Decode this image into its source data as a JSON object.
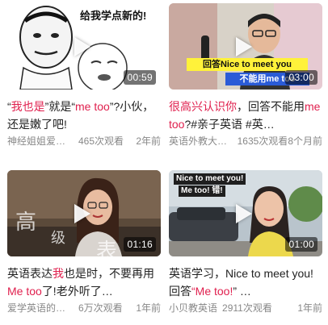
{
  "videos": [
    {
      "duration": "00:59",
      "title": [
        "“",
        "我也是",
        "”就是“",
        "me too",
        "”?小伙，还是嫩了吧!"
      ],
      "author": "神经姐姐爱英…",
      "views": "465次观看",
      "age": "2年前",
      "thumb_text": [
        "给我学点新的!"
      ]
    },
    {
      "duration": "03:00",
      "title": [
        "",
        "很高兴认识你",
        "，回答不能用",
        "me too",
        "?#亲子英语 #英…"
      ],
      "author": "英语外教大卫…",
      "views": "1635次观看",
      "age": "8个月前",
      "thumb_text": [
        "回答Nice to meet you",
        "不能用me too"
      ]
    },
    {
      "duration": "01:16",
      "title": [
        "英语表达",
        "我",
        "也是时，不要再用",
        "Me too",
        "了!老外听了…"
      ],
      "author": "爱学英语的小…",
      "views": "6万次观看",
      "age": "1年前",
      "thumb_text": [
        "高",
        "级",
        "表"
      ]
    },
    {
      "duration": "01:00",
      "title": [
        "英语学习，Nice to meet you! 回答",
        "“Me too!",
        "” …",
        "",
        ""
      ],
      "author": "小贝教英语",
      "views": "2911次观看",
      "age": "1年前",
      "thumb_text": [
        "Nice to meet you!",
        "Me too! 错!"
      ]
    }
  ],
  "colors": {
    "highlight": "#e0204e",
    "meta": "#888888"
  }
}
